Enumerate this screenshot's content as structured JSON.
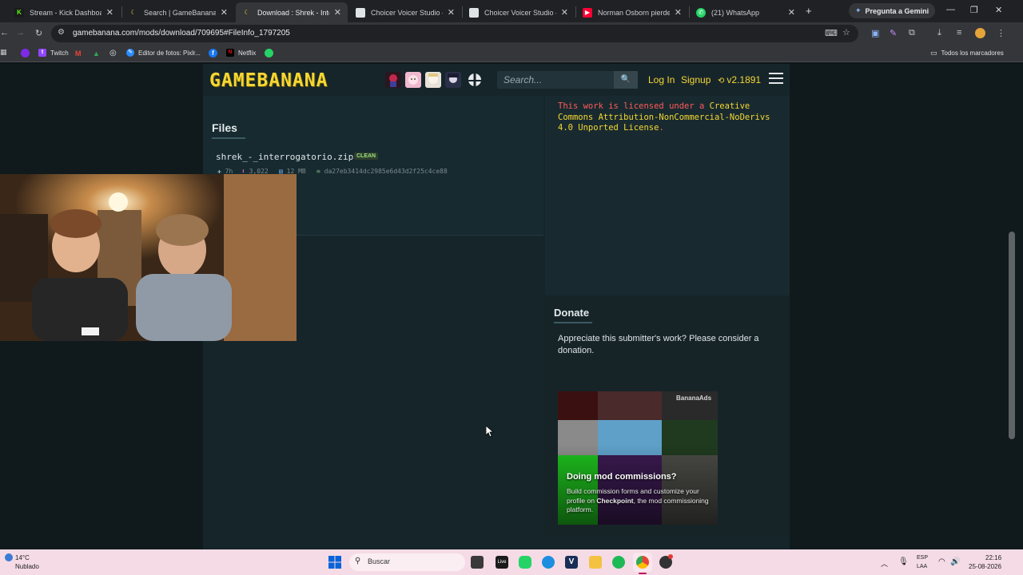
{
  "browser": {
    "tabs": [
      {
        "title": "Stream - Kick Dashboard",
        "active": false
      },
      {
        "title": "Search | GameBanana",
        "active": false
      },
      {
        "title": "Download : Shrek - Interro",
        "active": true
      },
      {
        "title": "Choicer Voicer Studio — F",
        "active": false
      },
      {
        "title": "Choicer Voicer Studio — F",
        "active": false
      },
      {
        "title": "Norman Osborn pierde el",
        "active": false
      },
      {
        "title": "(21) WhatsApp",
        "active": false
      }
    ],
    "new_tab": "+",
    "gemini_button": "Pregunta a Gemini",
    "url": "gamebanana.com/mods/download/709695#FileInfo_1797205",
    "bookmarks": [
      "Twitch",
      "Editor de fotos: Pixlr...",
      "Netflix"
    ],
    "all_bookmarks": "Todos los marcadores"
  },
  "site": {
    "logo": "GAMEBANANA",
    "search_placeholder": "Search...",
    "login": "Log In",
    "signup": "Signup",
    "version": "v2.1891"
  },
  "files": {
    "heading": "Files",
    "filename": "shrek_-_interrogatorio.zip",
    "badge": "CLEAN",
    "age": "7h",
    "downloads": "3,022",
    "size": "12 MB",
    "hash": "da27eb3414dc2985e6d43d2f25c4ce88"
  },
  "license": {
    "prefix": "This work is licensed under a",
    "link": "Creative Commons Attribution-NonCommercial-NoDerivs 4.0 Unported License",
    "suffix": "."
  },
  "donate": {
    "heading": "Donate",
    "text": "Appreciate this submitter's work? Please consider a donation."
  },
  "ad": {
    "label": "BananaAds",
    "title": "Doing mod commissions?",
    "text_pre": "Build commission forms and customize your profile on",
    "text_brand": "Checkpoint",
    "text_post": ", the mod commissioning platform."
  },
  "taskbar": {
    "weather_temp": "14°C",
    "weather_desc": "Nublado",
    "search_label": "Buscar",
    "lang_top": "ESP",
    "lang_bottom": "LAA",
    "time": "22:16",
    "date": "25-08-2026"
  }
}
